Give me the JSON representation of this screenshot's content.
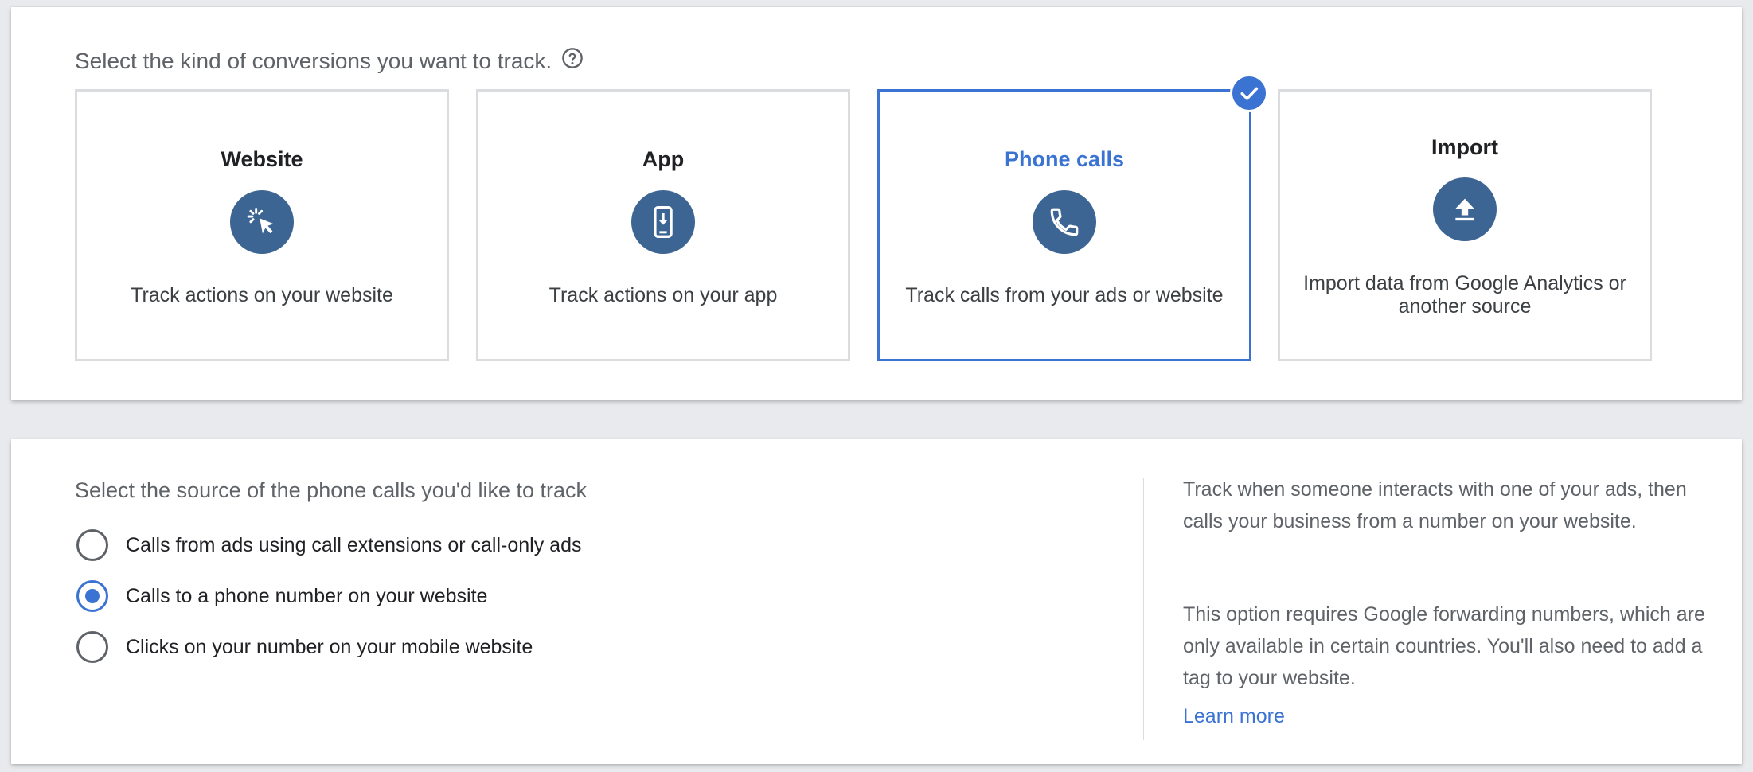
{
  "conversion_kind": {
    "question": "Select the kind of conversions you want to track.",
    "help_icon": "help-circle-icon",
    "cards": [
      {
        "title": "Website",
        "icon": "cursor-click-icon",
        "description": "Track actions on your website",
        "selected": false
      },
      {
        "title": "App",
        "icon": "phone-download-icon",
        "description": "Track actions on your app",
        "selected": false
      },
      {
        "title": "Phone calls",
        "icon": "phone-icon",
        "description": "Track calls from your ads or website",
        "selected": true
      },
      {
        "title": "Import",
        "icon": "upload-icon",
        "description": "Import data from Google Analytics or another source",
        "selected": false
      }
    ],
    "selected_badge_icon": "checkmark-icon"
  },
  "call_source": {
    "question": "Select the source of the phone calls you'd like to track",
    "options": [
      {
        "label": "Calls from ads using call extensions or call-only ads",
        "checked": false
      },
      {
        "label": "Calls to a phone number on your website",
        "checked": true
      },
      {
        "label": "Clicks on your number on your mobile website",
        "checked": false
      }
    ]
  },
  "info": {
    "paragraph_1": "Track when someone interacts with one of your ads, then calls your business from a number on your website.",
    "paragraph_2": "This option requires Google forwarding numbers, which are only available in certain countries. You'll also need to add a tag to your website.",
    "learn_more": "Learn more"
  },
  "colors": {
    "accent": "#3b73d2",
    "icon_circle": "#3d6593",
    "card_border": "#dadce0",
    "background": "#e8eaed"
  }
}
